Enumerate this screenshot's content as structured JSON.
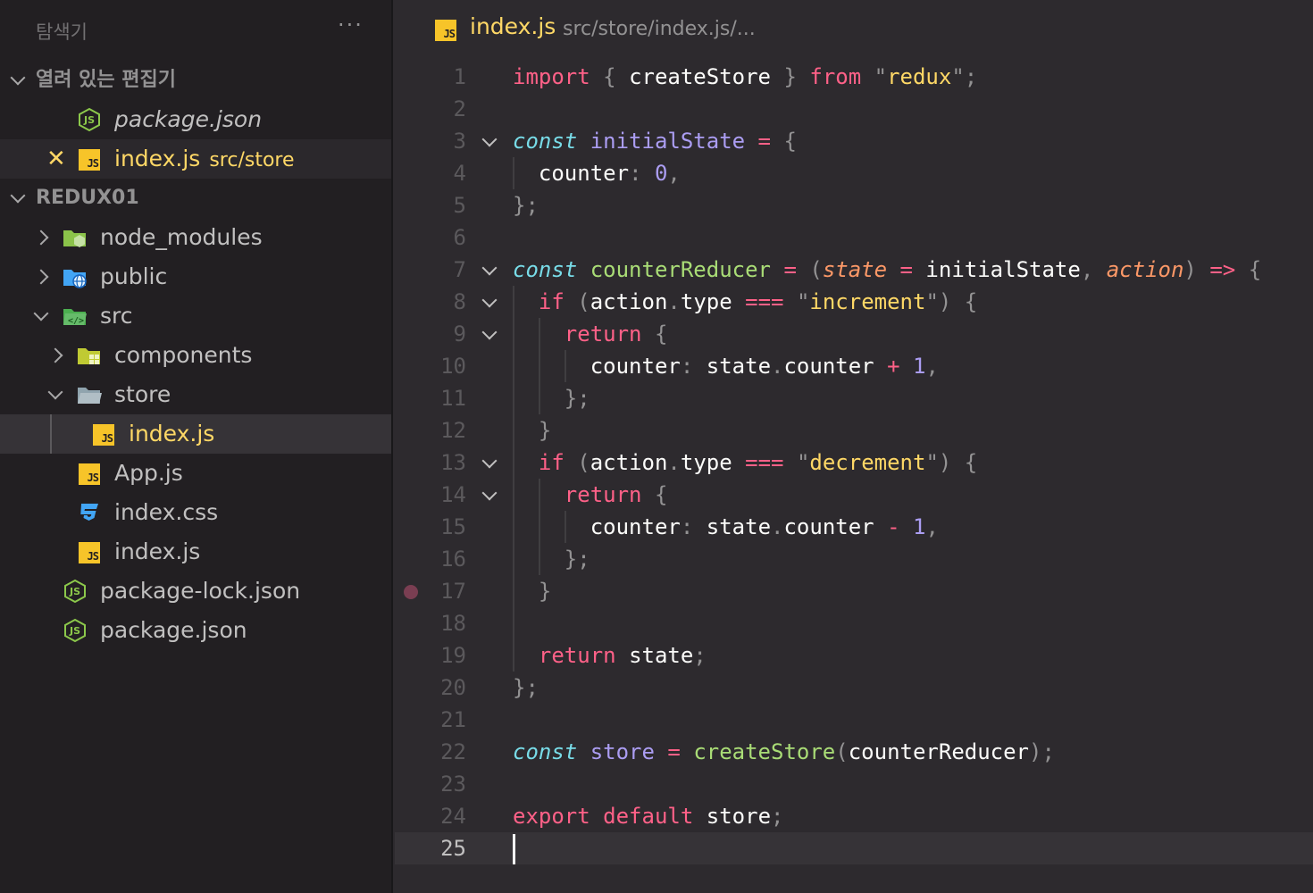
{
  "explorer": {
    "title": "탐색기",
    "more": "···",
    "open_editors": {
      "label": "열려 있는 편집기",
      "items": [
        {
          "name": "package.json",
          "icon": "nodejs-icon"
        },
        {
          "name": "index.js",
          "desc": "src/store",
          "icon": "js-icon"
        }
      ]
    },
    "project": {
      "label": "REDUX01",
      "items": [
        {
          "name": "node_modules",
          "icon": "node-folder-icon"
        },
        {
          "name": "public",
          "icon": "public-folder-icon"
        },
        {
          "name": "src",
          "icon": "src-folder-icon"
        },
        {
          "name": "components",
          "icon": "components-folder-icon"
        },
        {
          "name": "store",
          "icon": "folder-open-icon"
        },
        {
          "name": "index.js",
          "icon": "js-icon"
        },
        {
          "name": "App.js",
          "icon": "js-icon"
        },
        {
          "name": "index.css",
          "icon": "css-icon"
        },
        {
          "name": "index.js",
          "icon": "js-icon"
        },
        {
          "name": "package-lock.json",
          "icon": "nodejs-icon"
        },
        {
          "name": "package.json",
          "icon": "nodejs-icon"
        }
      ]
    }
  },
  "tab": {
    "name": "index.js",
    "path": "src/store/index.js/...",
    "badge": "JS"
  },
  "editor": {
    "current_line": 25,
    "breakpoint_line": 17,
    "line_numbers": [
      "1",
      "2",
      "3",
      "4",
      "5",
      "6",
      "7",
      "8",
      "9",
      "10",
      "11",
      "12",
      "13",
      "14",
      "15",
      "16",
      "17",
      "18",
      "19",
      "20",
      "21",
      "22",
      "23",
      "24",
      "25"
    ],
    "code": [
      "import { createStore } from \"redux\";",
      "",
      "const initialState = {",
      "  counter: 0,",
      "};",
      "",
      "const counterReducer = (state = initialState, action) => {",
      "  if (action.type === \"increment\") {",
      "    return {",
      "      counter: state.counter + 1,",
      "    };",
      "  }",
      "  if (action.type === \"decrement\") {",
      "    return {",
      "      counter: state.counter - 1,",
      "    };",
      "  }",
      "",
      "  return state;",
      "};",
      "",
      "const store = createStore(counterReducer);",
      "",
      "export default store;",
      ""
    ]
  },
  "colors": {
    "keyword": "#ff6188",
    "string": "#ffd866",
    "storage": "#78dce8",
    "variable": "#ab9df2",
    "function": "#a9dc76",
    "parameter": "#fc9867",
    "background": "#2d2a2e",
    "sidebar": "#221f22"
  }
}
